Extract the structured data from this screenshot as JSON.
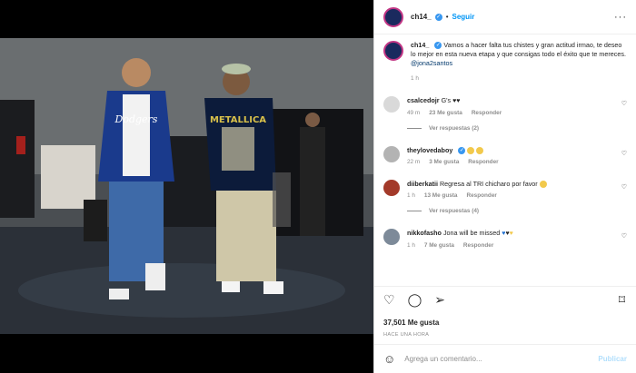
{
  "post": {
    "username": "ch14_",
    "follow_label": "Seguir",
    "caption_user": "ch14_",
    "caption_text": "Vamos a hacer falta tus chistes y gran actitud irmao, te deseo lo mejor en esta nueva etapa y que consigas todo el éxito que te mereces.",
    "caption_mention": "@jona2santos",
    "caption_time": "1 h",
    "likes": "37,501 Me gusta",
    "time_ago": "HACE UNA HORA"
  },
  "comments": [
    {
      "user": "csalcedojr",
      "text": "G's",
      "time": "49 m",
      "likes": "23 Me gusta",
      "reply": "Responder",
      "replies": "Ver respuestas (2)"
    },
    {
      "user": "theylovedaboy",
      "text": "",
      "time": "22 m",
      "likes": "3 Me gusta",
      "reply": "Responder",
      "replies": ""
    },
    {
      "user": "diiberkatii",
      "text": "Regresa al TRI chicharo por favor",
      "time": "1 h",
      "likes": "13 Me gusta",
      "reply": "Responder",
      "replies": "Ver respuestas (4)"
    },
    {
      "user": "nikkofasho",
      "text": "Jona will be missed",
      "time": "1 h",
      "likes": "7 Me gusta",
      "reply": "Responder",
      "replies": ""
    }
  ],
  "composer": {
    "placeholder": "Agrega un comentario...",
    "publish_label": "Publicar"
  },
  "photo": {
    "jacket_text": "Dodgers",
    "shirt_text": "METALLICA"
  },
  "colors": {
    "accent": "#0095f6",
    "verified": "#3897f0"
  },
  "icons": [
    "more-icon",
    "heart-icon",
    "comment-icon",
    "share-icon",
    "bookmark-icon",
    "emoji-icon"
  ]
}
